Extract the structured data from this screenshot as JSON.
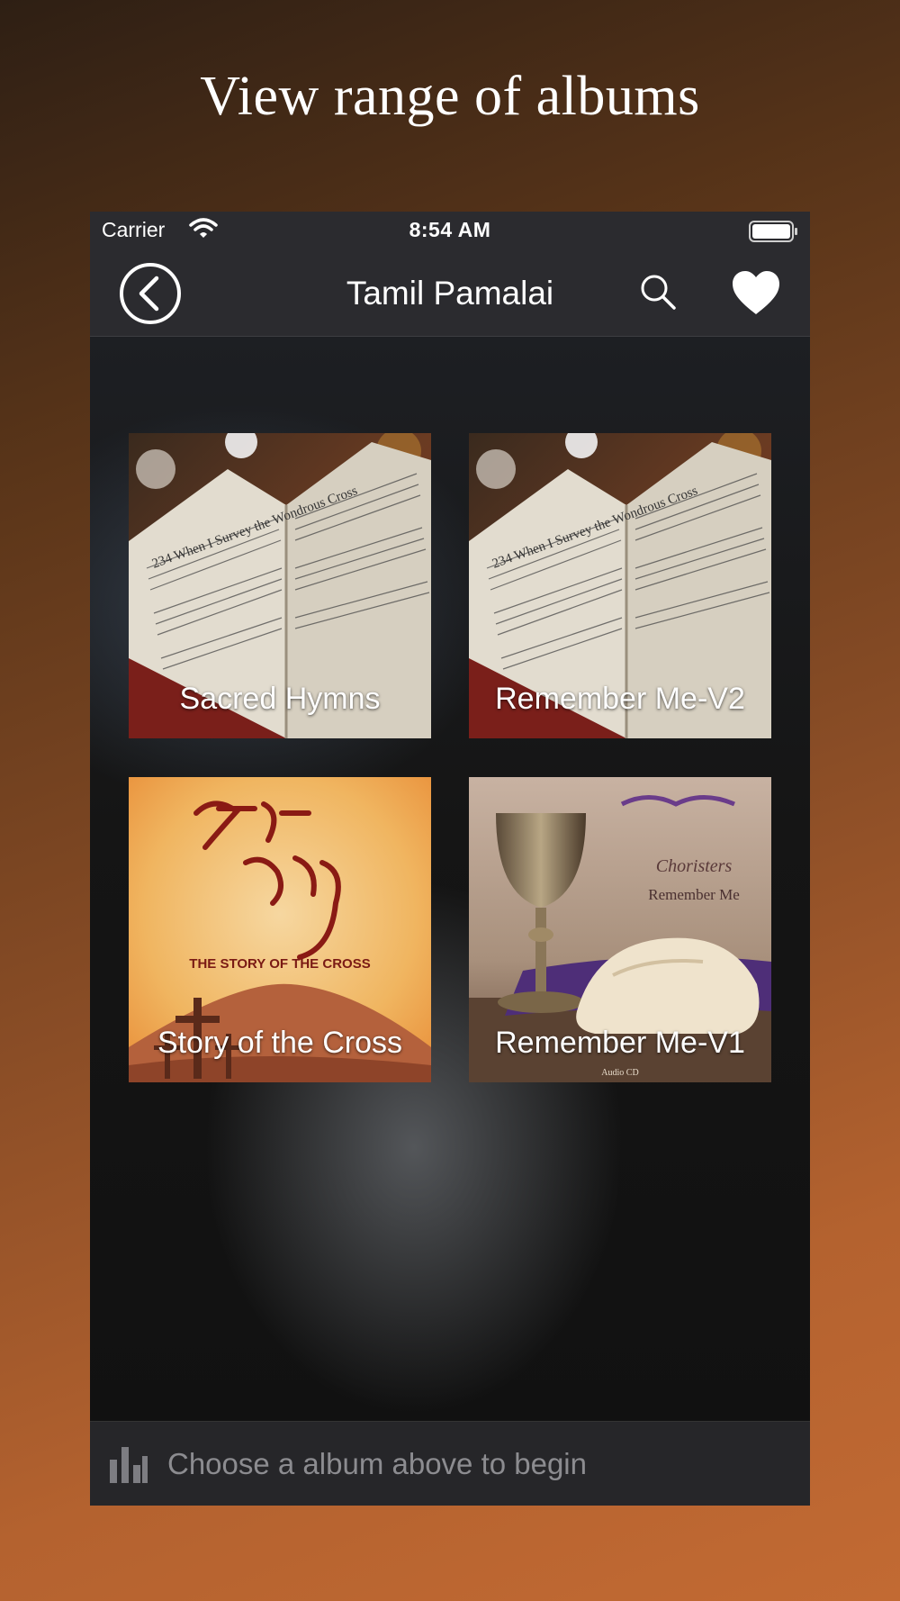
{
  "headline": "View range of albums",
  "status_bar": {
    "carrier": "Carrier",
    "time": "8:54 AM"
  },
  "nav": {
    "title": "Tamil Pamalai",
    "icons": {
      "back": "chevron-left-circle-icon",
      "search": "search-icon",
      "favorite": "heart-icon"
    }
  },
  "albums": [
    {
      "label": "Sacred Hymns",
      "art_text": "234 When I Survey the Wondrous Cross"
    },
    {
      "label": "Remember Me-V2",
      "art_text": "234 When I Survey the Wondrous Cross"
    },
    {
      "label": "Story of the Cross",
      "art_text": "THE STORY OF THE CROSS"
    },
    {
      "label": "Remember Me-V1",
      "art_text": "Choristers",
      "art_subtitle": "Remember Me",
      "art_footer": "Audio CD"
    }
  ],
  "now_playing": {
    "placeholder": "Choose a album above to begin",
    "icon": "audio-bars-icon"
  },
  "colors": {
    "accent_text": "#ffffff",
    "muted_text": "#8c8c90",
    "bar_bg": "#2b2b2f"
  }
}
